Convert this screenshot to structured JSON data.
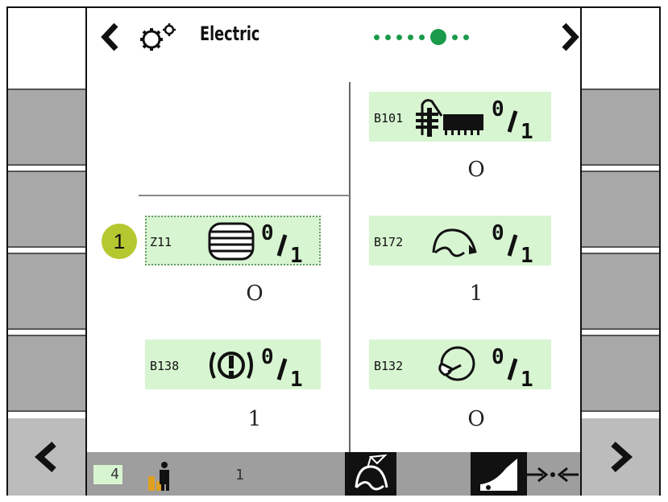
{
  "header": {
    "title": "Electric",
    "page_dots": 8,
    "active_dot": 5
  },
  "marker": {
    "label": "1"
  },
  "left_tiles": [
    {
      "code": "Z11",
      "icon": "coil-icon",
      "value": "O"
    },
    {
      "code": "B138",
      "icon": "brake-warning-icon",
      "value": "1"
    }
  ],
  "right_tiles": [
    {
      "code": "B101",
      "icon": "header-feeder-icon",
      "value": "O"
    },
    {
      "code": "B172",
      "icon": "reel-icon",
      "value": "1"
    },
    {
      "code": "B132",
      "icon": "rotor-icon",
      "value": "O"
    }
  ],
  "bottom": {
    "gear": "4",
    "count": "1"
  },
  "colors": {
    "tile_bg": "#d8f5d2",
    "accent_green": "#1a9a4a",
    "marker": "#b5c830"
  }
}
